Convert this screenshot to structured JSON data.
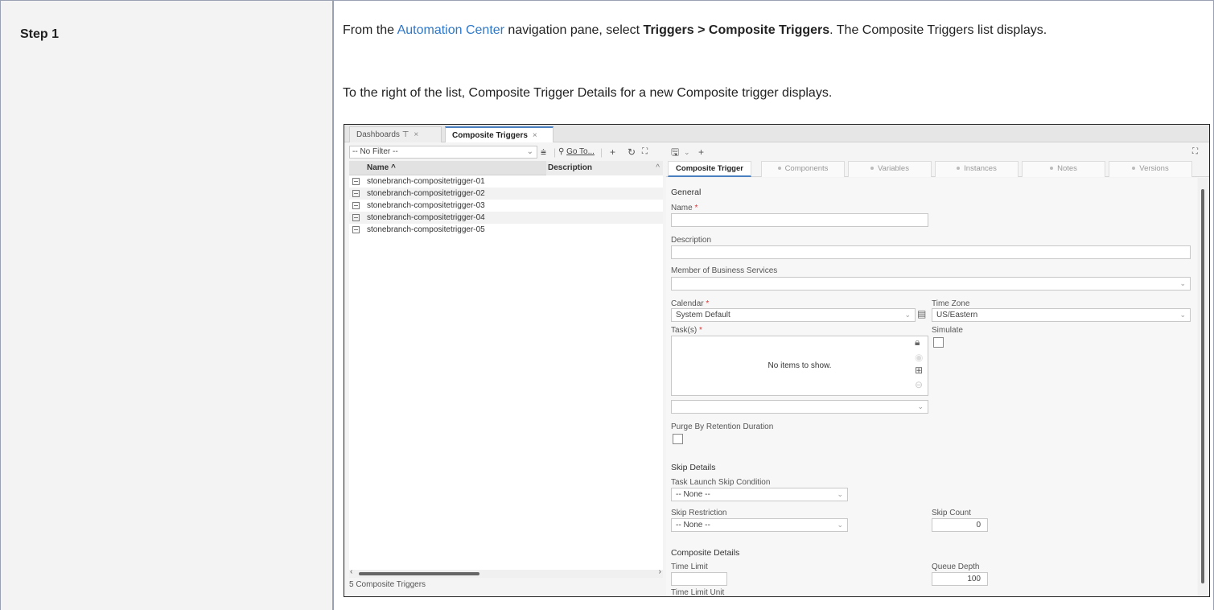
{
  "step_label": "Step 1",
  "para1": {
    "prefix": "From the ",
    "link": "Automation Center",
    "mid": " navigation pane, select ",
    "bold": "Triggers > Composite Triggers",
    "suffix": ". The Composite Triggers list displays."
  },
  "para2": "To the right of the list, Composite Trigger Details for a new Composite trigger displays.",
  "app": {
    "tabs": [
      {
        "label": "Dashboards",
        "pin": "⊤",
        "close": "×"
      },
      {
        "label": "Composite Triggers",
        "close": "×"
      }
    ],
    "filter_value": "-- No Filter --",
    "goto_label": "Go To...",
    "list": {
      "col_name": "Name",
      "col_desc": "Description",
      "rows": [
        "stonebranch-compositetrigger-01",
        "stonebranch-compositetrigger-02",
        "stonebranch-compositetrigger-03",
        "stonebranch-compositetrigger-04",
        "stonebranch-compositetrigger-05"
      ],
      "footer": "5 Composite Triggers"
    },
    "detail_tabs": [
      "Composite Trigger",
      "Components",
      "Variables",
      "Instances",
      "Notes",
      "Versions"
    ],
    "form": {
      "general": "General",
      "name_label": "Name",
      "description_label": "Description",
      "member_label": "Member of Business Services",
      "calendar_label": "Calendar",
      "calendar_value": "System Default",
      "timezone_label": "Time Zone",
      "timezone_value": "US/Eastern",
      "tasks_label": "Task(s)",
      "tasks_empty": "No items to show.",
      "simulate_label": "Simulate",
      "purge_label": "Purge By Retention Duration",
      "skip_details": "Skip Details",
      "skip_cond_label": "Task Launch Skip Condition",
      "skip_cond_value": "-- None --",
      "skip_restr_label": "Skip Restriction",
      "skip_restr_value": "-- None --",
      "skip_count_label": "Skip Count",
      "skip_count_value": "0",
      "composite_details": "Composite Details",
      "time_limit_label": "Time Limit",
      "queue_depth_label": "Queue Depth",
      "queue_depth_value": "100",
      "time_limit_unit_label": "Time Limit Unit",
      "required_mark": "*"
    }
  }
}
